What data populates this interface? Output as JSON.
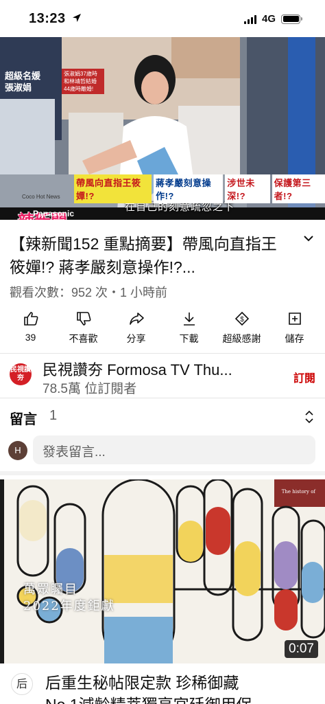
{
  "status_bar": {
    "time": "13:23",
    "network": "4G"
  },
  "video": {
    "tag_name_line1": "超級名媛",
    "tag_name_line2": "張淑娟",
    "tag_note": "張淑娟37歲時和林靖哲結婚44歲時離婚!",
    "subtitle": "在自己的刻意疏忽之下",
    "show_logo": "辣新聞",
    "show_sub": "Coco Hot News",
    "sponsor": "Panasonic",
    "ticker": [
      "帶風向直指王筱嬋!?",
      "蔣孝嚴刻意操作!?",
      "涉世未深!?",
      "保護第三者!?"
    ]
  },
  "title": "【辣新聞152 重點摘要】帶風向直指王筱嬋!? 蔣孝嚴刻意操作!?...",
  "meta": "觀看次數：952 次・1 小時前",
  "actions": [
    {
      "label": "39",
      "icon": "like-icon"
    },
    {
      "label": "不喜歡",
      "icon": "dislike-icon"
    },
    {
      "label": "分享",
      "icon": "share-icon"
    },
    {
      "label": "下載",
      "icon": "download-icon"
    },
    {
      "label": "超級感謝",
      "icon": "super-thanks-icon"
    },
    {
      "label": "儲存",
      "icon": "save-icon"
    }
  ],
  "channel": {
    "avatar_text": "民視讚夯",
    "name": "民視讚夯 Formosa TV Thu...",
    "subscribers": "78.5萬 位訂閱者",
    "subscribe_label": "訂閱"
  },
  "comments": {
    "title": "留言",
    "count": "1",
    "user_initial": "H",
    "placeholder": "發表留言..."
  },
  "next_video": {
    "thumb_line1": "萬眾矚目",
    "thumb_line2": "2022年度鉅獻",
    "duration": "0:07",
    "brand": "The history of",
    "channel_logo": "后",
    "title_line1": "后重生秘帖限定款 珍稀御藏",
    "title_line2": "No.1減齡精萃獨享宮廷御用保"
  },
  "colors": {
    "accent_red": "#cc0000",
    "text_secondary": "#606060"
  }
}
